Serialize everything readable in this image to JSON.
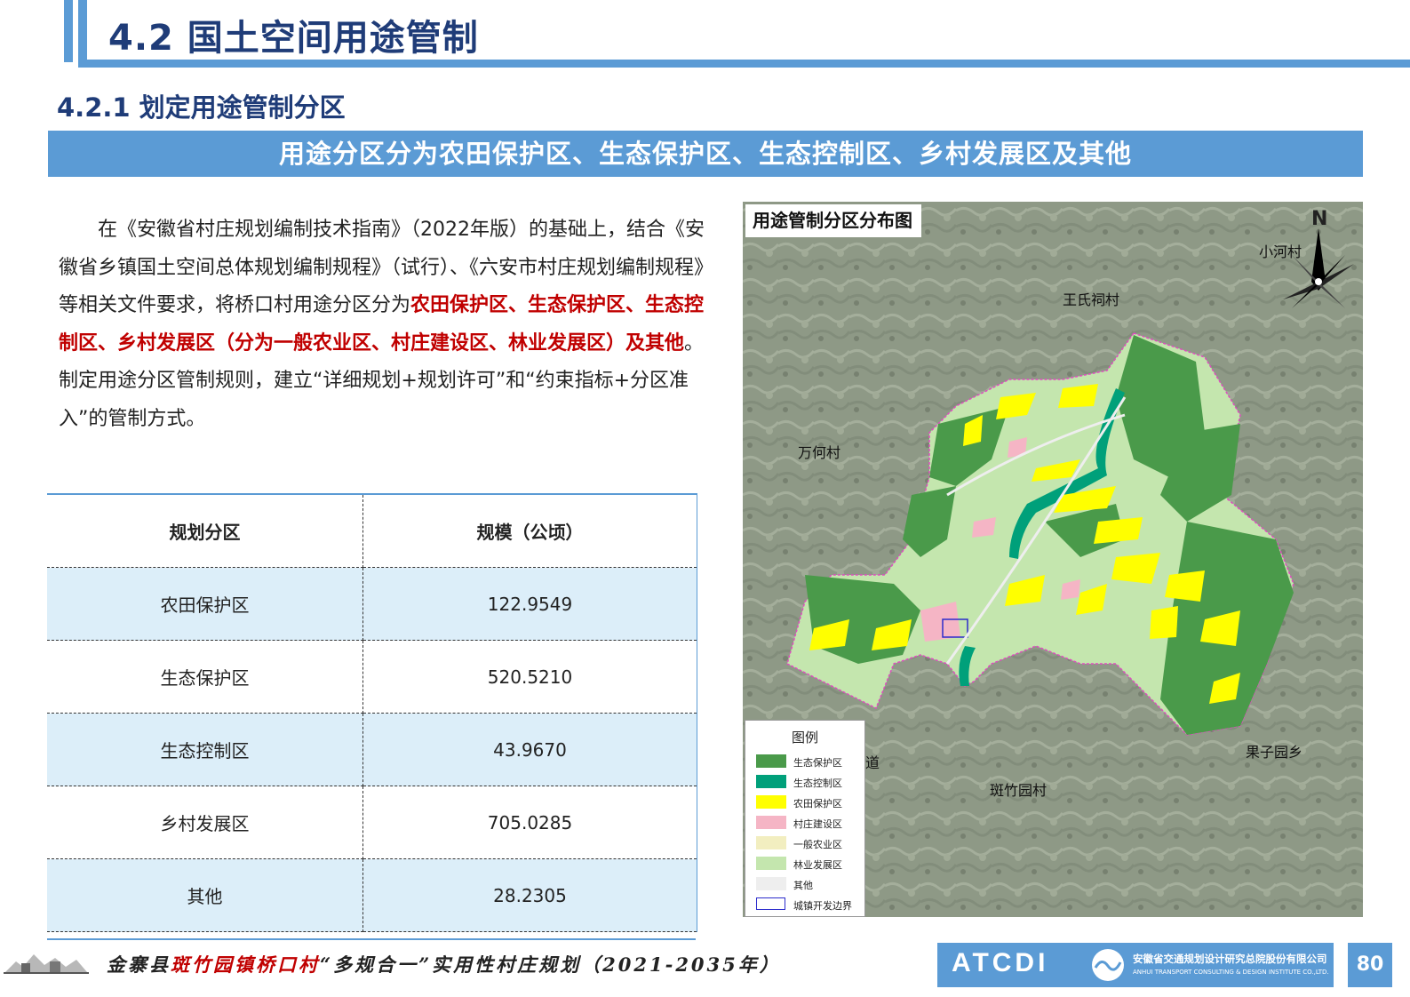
{
  "header": {
    "title": "4.2 国土空间用途管制"
  },
  "section": {
    "title": "4.2.1 划定用途管制分区"
  },
  "banner": {
    "text": "用途分区分为农田保护区、生态保护区、生态控制区、乡村发展区及其他"
  },
  "paragraph": {
    "part1": "在《安徽省村庄规划编制技术指南》（2022年版）的基础上，结合《安徽省乡镇国土空间总体规划编制规程》（试行）、《六安市村庄规划编制规程》等相关文件要求，将桥口村用途分区分为",
    "highlight": "农田保护区、生态保护区、生态控制区、乡村发展区（分为一般农业区、村庄建设区、林业发展区）及其他",
    "part2": "。制定用途分区管制规则，建立“详细规划+规划许可”和“约束指标+分区准入”的管制方式。"
  },
  "table": {
    "headers": [
      "规划分区",
      "规模（公顷）"
    ],
    "rows": [
      {
        "zone": "农田保护区",
        "area": "122.9549"
      },
      {
        "zone": "生态保护区",
        "area": "520.5210"
      },
      {
        "zone": "生态控制区",
        "area": "43.9670"
      },
      {
        "zone": "乡村发展区",
        "area": "705.0285"
      },
      {
        "zone": "其他",
        "area": "28.2305"
      }
    ]
  },
  "map": {
    "title": "用途管制分区分布图",
    "north": "N",
    "labels": {
      "xiaohe": "小河村",
      "wangshi": "王氏祠村",
      "wanhe": "万何村",
      "guozi": "果子园乡",
      "banzhu": "斑竹园村",
      "dao": "道"
    },
    "legend": {
      "title": "图例",
      "items": [
        {
          "label": "生态保护区",
          "color": "#4a9a4a"
        },
        {
          "label": "生态控制区",
          "color": "#00a07a"
        },
        {
          "label": "农田保护区",
          "color": "#ffff00"
        },
        {
          "label": "村庄建设区",
          "color": "#f5b5c5"
        },
        {
          "label": "一般农业区",
          "color": "#f2eec0"
        },
        {
          "label": "林业发展区",
          "color": "#c4e6ae"
        },
        {
          "label": "其他",
          "color": "#eeeeee"
        },
        {
          "label": "城镇开发边界",
          "color": "#2c2ccc"
        }
      ]
    }
  },
  "footer": {
    "prefix": "金寨县",
    "red": "斑竹园镇桥口村",
    "suffix": "“多规合一”实用性村庄规划（2021-2035年）",
    "logo": "ATCDI",
    "company_cn": "安徽省交通规划设计研究总院股份有限公司",
    "company_en": "ANHUI TRANSPORT CONSULTING & DESIGN INSTITUTE CO.,LTD.",
    "page": "80"
  }
}
